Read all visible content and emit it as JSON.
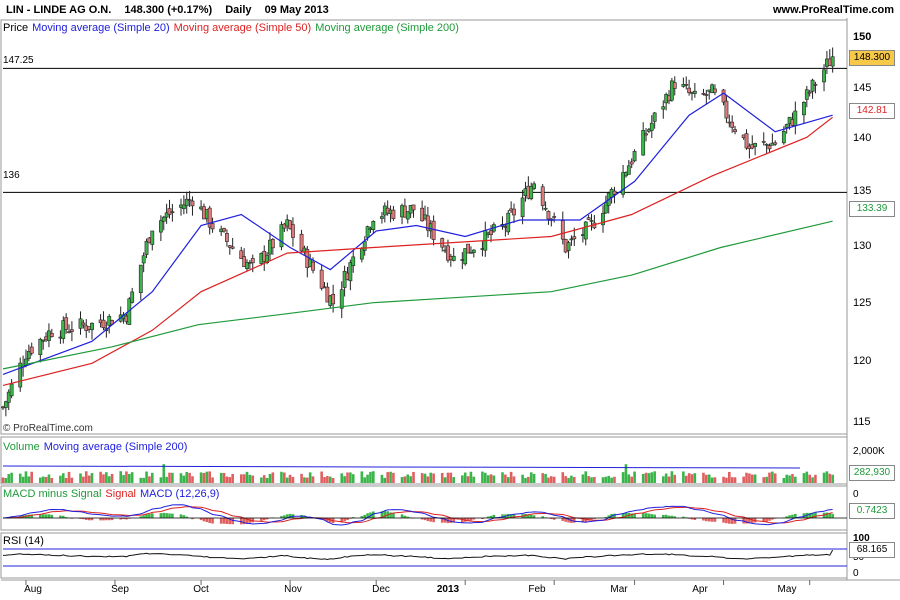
{
  "header": {
    "symbol": "LIN - LINDE AG O.N.",
    "quote": "148.300 (+0.17%)",
    "period": "Daily",
    "date": "09 May 2013",
    "site": "www.ProRealTime.com"
  },
  "copyright": "© ProRealTime.com",
  "colors": {
    "sma20": "#2020dd",
    "sma50": "#dd2222",
    "sma200": "#1f9a3a",
    "up_candle": "#3ab54a",
    "down_candle": "#e07a7a",
    "price_badge": "#f7c948",
    "volume_up": "#39b54a",
    "volume_down": "#e06060"
  },
  "price_panel": {
    "legend": {
      "prefix": "Price",
      "sma20": "Moving average (Simple 20)",
      "sma50": "Moving average (Simple 50)",
      "sma200": "Moving average (Simple 200)"
    },
    "levels": [
      {
        "label": "147.25",
        "value": 147.25
      },
      {
        "label": "136",
        "value": 136
      }
    ],
    "y_ticks": [
      "150",
      "145",
      "140",
      "135",
      "130",
      "125",
      "120",
      "115"
    ],
    "badges": {
      "last": "148.300",
      "sma50": "142.81",
      "sma200": "133.39"
    }
  },
  "volume_panel": {
    "legend": {
      "prefix": "Volume",
      "ma": "Moving average (Simple 200)"
    },
    "y_tick": "2,000K",
    "badge": "282,930"
  },
  "macd_panel": {
    "legend": {
      "diff": "MACD minus Signal",
      "signal": "Signal",
      "macd": "MACD (12,26,9)"
    },
    "y_tick": "0",
    "badge": "0.7423"
  },
  "rsi_panel": {
    "legend": "RSI (14)",
    "y_ticks": [
      "100",
      "50",
      "0"
    ],
    "badge": "68.165"
  },
  "x_axis": {
    "labels": [
      "Aug",
      "Sep",
      "Oct",
      "Nov",
      "Dec",
      "2013",
      "Feb",
      "Mar",
      "Apr",
      "May"
    ]
  },
  "chart_data": {
    "type": "candlestick",
    "title": "LIN - LINDE AG O.N.",
    "ylim": [
      114,
      152
    ],
    "grid": false,
    "last_close": 148.3,
    "change_pct": 0.17,
    "price_path": [
      [
        "2012-07-24",
        116.5
      ],
      [
        "2012-08-01",
        121.5
      ],
      [
        "2012-08-10",
        123.5
      ],
      [
        "2012-08-24",
        124.0
      ],
      [
        "2012-09-05",
        125.0
      ],
      [
        "2012-09-14",
        133.0
      ],
      [
        "2012-09-28",
        135.5
      ],
      [
        "2012-10-05",
        133.0
      ],
      [
        "2012-10-19",
        129.0
      ],
      [
        "2012-10-31",
        133.0
      ],
      [
        "2012-11-09",
        129.0
      ],
      [
        "2012-11-16",
        126.0
      ],
      [
        "2012-11-30",
        134.0
      ],
      [
        "2012-12-14",
        134.5
      ],
      [
        "2012-12-28",
        130.0
      ],
      [
        "2013-01-15",
        133.0
      ],
      [
        "2013-01-25",
        137.0
      ],
      [
        "2013-02-05",
        131.0
      ],
      [
        "2013-02-14",
        133.0
      ],
      [
        "2013-02-28",
        139.0
      ],
      [
        "2013-03-15",
        146.0
      ],
      [
        "2013-03-22",
        144.5
      ],
      [
        "2013-03-28",
        145.0
      ],
      [
        "2013-04-10",
        140.0
      ],
      [
        "2013-04-19",
        140.5
      ],
      [
        "2013-04-26",
        143.0
      ],
      [
        "2013-05-03",
        146.0
      ],
      [
        "2013-05-09",
        148.3
      ]
    ],
    "series": [
      {
        "name": "Moving average (Simple 20)",
        "values": [
          [
            "2012-07-24",
            119.5
          ],
          [
            "2012-08-24",
            122.5
          ],
          [
            "2012-09-14",
            127.0
          ],
          [
            "2012-10-01",
            133.0
          ],
          [
            "2012-10-15",
            134.0
          ],
          [
            "2012-11-01",
            131.0
          ],
          [
            "2012-11-15",
            129.0
          ],
          [
            "2012-12-01",
            132.5
          ],
          [
            "2012-12-15",
            133.0
          ],
          [
            "2013-01-01",
            132.0
          ],
          [
            "2013-01-20",
            133.5
          ],
          [
            "2013-02-10",
            133.5
          ],
          [
            "2013-03-01",
            137.0
          ],
          [
            "2013-03-20",
            143.0
          ],
          [
            "2013-04-01",
            145.0
          ],
          [
            "2013-04-19",
            141.5
          ],
          [
            "2013-05-09",
            143.0
          ]
        ]
      },
      {
        "name": "Moving average (Simple 50)",
        "values": [
          [
            "2012-07-24",
            118.5
          ],
          [
            "2012-08-24",
            120.5
          ],
          [
            "2012-09-14",
            123.5
          ],
          [
            "2012-10-01",
            127.0
          ],
          [
            "2012-10-31",
            130.5
          ],
          [
            "2012-11-30",
            131.0
          ],
          [
            "2012-12-31",
            131.5
          ],
          [
            "2013-01-31",
            132.0
          ],
          [
            "2013-02-28",
            134.0
          ],
          [
            "2013-03-28",
            137.5
          ],
          [
            "2013-04-30",
            141.0
          ],
          [
            "2013-05-09",
            142.81
          ]
        ]
      },
      {
        "name": "Moving average (Simple 200)",
        "values": [
          [
            "2012-07-24",
            120.0
          ],
          [
            "2012-08-31",
            122.0
          ],
          [
            "2012-09-30",
            124.0
          ],
          [
            "2012-10-31",
            125.0
          ],
          [
            "2012-11-30",
            126.0
          ],
          [
            "2012-12-31",
            126.5
          ],
          [
            "2013-01-31",
            127.0
          ],
          [
            "2013-02-28",
            128.5
          ],
          [
            "2013-03-31",
            131.0
          ],
          [
            "2013-05-09",
            133.39
          ]
        ]
      }
    ],
    "volume_ma": 282930,
    "macd_last": 0.7423,
    "rsi_last": 68.165
  }
}
